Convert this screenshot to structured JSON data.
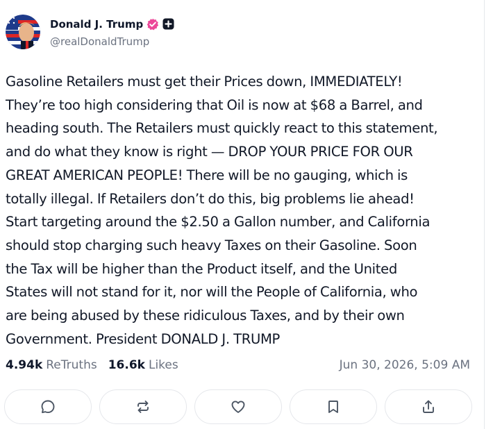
{
  "author": {
    "display_name": "Donald J. Trump",
    "handle": "@realDonaldTrump",
    "avatar_icon": "avatar-flag-portrait",
    "verified_color": "#ec4899"
  },
  "post": {
    "text": "Gasoline Retailers must get their Prices down, IMMEDIATELY!\nThey’re too high considering that Oil is now at $68 a Barrel, and\nheading south. The Retailers must quickly react to this statement,\nand do what they know is right — DROP YOUR PRICE FOR OUR\nGREAT AMERICAN PEOPLE! There will be no gauging, which is\ntotally illegal. If Retailers don’t do this, big problems lie ahead!\nStart targeting around the $2.50 a Gallon number, and California\nshould stop charging such heavy Taxes on their Gasoline. Soon\nthe Tax will be higher than the Product itself, and the United\nStates will not stand for it, nor will the People of California, who\nare being abused by these ridiculous Taxes, and by their own\nGovernment. President DONALD J. TRUMP",
    "retruths_count": "4.94k",
    "retruths_label": "ReTruths",
    "likes_count": "16.6k",
    "likes_label": "Likes",
    "timestamp": "Jun 30, 2026, 5:09 AM"
  },
  "actions": [
    {
      "icon": "reply-icon"
    },
    {
      "icon": "retruth-icon"
    },
    {
      "icon": "like-icon"
    },
    {
      "icon": "bookmark-icon"
    },
    {
      "icon": "share-icon"
    }
  ],
  "colors": {
    "icon": "#4b5563",
    "muted": "#6b7280",
    "border": "#e5e7eb"
  }
}
